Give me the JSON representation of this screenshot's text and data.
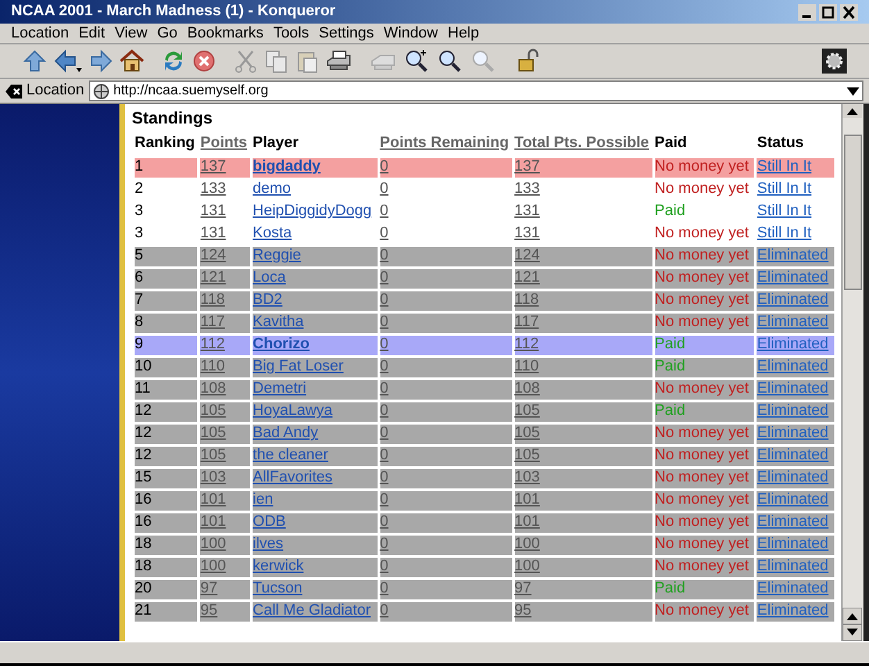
{
  "window": {
    "title": "NCAA 2001 - March Madness (1) - Konqueror"
  },
  "menu": [
    "Location",
    "Edit",
    "View",
    "Go",
    "Bookmarks",
    "Tools",
    "Settings",
    "Window",
    "Help"
  ],
  "location_bar": {
    "label": "Location",
    "url": "http://ncaa.suemyself.org"
  },
  "page": {
    "heading": "Standings",
    "columns": [
      {
        "label": "Ranking",
        "kind": "plain"
      },
      {
        "label": "Points",
        "kind": "link"
      },
      {
        "label": "Player",
        "kind": "plain"
      },
      {
        "label": "Points Remaining",
        "kind": "link"
      },
      {
        "label": "Total Pts. Possible",
        "kind": "link"
      },
      {
        "label": "Paid",
        "kind": "plain"
      },
      {
        "label": "Status",
        "kind": "plain"
      }
    ],
    "rows": [
      {
        "kind": "leader",
        "rank": "1",
        "points": "137",
        "player": "bigdaddy",
        "remaining": "0",
        "total": "137",
        "paid": false,
        "paid_text": "No money yet",
        "status": "Still In It"
      },
      {
        "kind": "active",
        "rank": "2",
        "points": "133",
        "player": "demo",
        "remaining": "0",
        "total": "133",
        "paid": false,
        "paid_text": "No money yet",
        "status": "Still In It"
      },
      {
        "kind": "active",
        "rank": "3",
        "points": "131",
        "player": "HeipDiggidyDogg",
        "remaining": "0",
        "total": "131",
        "paid": true,
        "paid_text": "Paid",
        "status": "Still In It"
      },
      {
        "kind": "active",
        "rank": "3",
        "points": "131",
        "player": "Kosta",
        "remaining": "0",
        "total": "131",
        "paid": false,
        "paid_text": "No money yet",
        "status": "Still In It"
      },
      {
        "kind": "eliminated",
        "rank": "5",
        "points": "124",
        "player": "Reggie",
        "remaining": "0",
        "total": "124",
        "paid": false,
        "paid_text": "No money yet",
        "status": "Eliminated"
      },
      {
        "kind": "eliminated",
        "rank": "6",
        "points": "121",
        "player": "Loca",
        "remaining": "0",
        "total": "121",
        "paid": false,
        "paid_text": "No money yet",
        "status": "Eliminated"
      },
      {
        "kind": "eliminated",
        "rank": "7",
        "points": "118",
        "player": "BD2",
        "remaining": "0",
        "total": "118",
        "paid": false,
        "paid_text": "No money yet",
        "status": "Eliminated"
      },
      {
        "kind": "eliminated",
        "rank": "8",
        "points": "117",
        "player": "Kavitha",
        "remaining": "0",
        "total": "117",
        "paid": false,
        "paid_text": "No money yet",
        "status": "Eliminated"
      },
      {
        "kind": "current",
        "rank": "9",
        "points": "112",
        "player": "Chorizo",
        "remaining": "0",
        "total": "112",
        "paid": true,
        "paid_text": "Paid",
        "status": "Eliminated"
      },
      {
        "kind": "eliminated",
        "rank": "10",
        "points": "110",
        "player": "Big Fat Loser",
        "remaining": "0",
        "total": "110",
        "paid": true,
        "paid_text": "Paid",
        "status": "Eliminated"
      },
      {
        "kind": "eliminated",
        "rank": "11",
        "points": "108",
        "player": "Demetri",
        "remaining": "0",
        "total": "108",
        "paid": false,
        "paid_text": "No money yet",
        "status": "Eliminated"
      },
      {
        "kind": "eliminated",
        "rank": "12",
        "points": "105",
        "player": "HoyaLawya",
        "remaining": "0",
        "total": "105",
        "paid": true,
        "paid_text": "Paid",
        "status": "Eliminated"
      },
      {
        "kind": "eliminated",
        "rank": "12",
        "points": "105",
        "player": "Bad Andy",
        "remaining": "0",
        "total": "105",
        "paid": false,
        "paid_text": "No money yet",
        "status": "Eliminated"
      },
      {
        "kind": "eliminated",
        "rank": "12",
        "points": "105",
        "player": "the cleaner",
        "remaining": "0",
        "total": "105",
        "paid": false,
        "paid_text": "No money yet",
        "status": "Eliminated"
      },
      {
        "kind": "eliminated",
        "rank": "15",
        "points": "103",
        "player": "AllFavorites",
        "remaining": "0",
        "total": "103",
        "paid": false,
        "paid_text": "No money yet",
        "status": "Eliminated"
      },
      {
        "kind": "eliminated",
        "rank": "16",
        "points": "101",
        "player": "ien",
        "remaining": "0",
        "total": "101",
        "paid": false,
        "paid_text": "No money yet",
        "status": "Eliminated"
      },
      {
        "kind": "eliminated",
        "rank": "16",
        "points": "101",
        "player": "ODB",
        "remaining": "0",
        "total": "101",
        "paid": false,
        "paid_text": "No money yet",
        "status": "Eliminated"
      },
      {
        "kind": "eliminated",
        "rank": "18",
        "points": "100",
        "player": "ilves",
        "remaining": "0",
        "total": "100",
        "paid": false,
        "paid_text": "No money yet",
        "status": "Eliminated"
      },
      {
        "kind": "eliminated",
        "rank": "18",
        "points": "100",
        "player": "kerwick",
        "remaining": "0",
        "total": "100",
        "paid": false,
        "paid_text": "No money yet",
        "status": "Eliminated"
      },
      {
        "kind": "eliminated",
        "rank": "20",
        "points": "97",
        "player": "Tucson",
        "remaining": "0",
        "total": "97",
        "paid": true,
        "paid_text": "Paid",
        "status": "Eliminated"
      },
      {
        "kind": "eliminated",
        "rank": "21",
        "points": "95",
        "player": "Call Me Gladiator",
        "remaining": "0",
        "total": "95",
        "paid": false,
        "paid_text": "No money yet",
        "status": "Eliminated"
      }
    ]
  }
}
